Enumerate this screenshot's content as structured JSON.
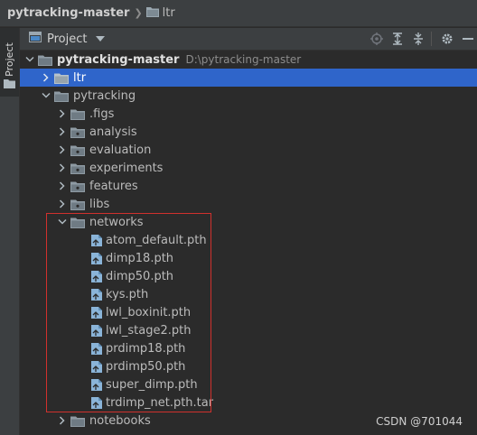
{
  "breadcrumb": {
    "root": "pytracking-master",
    "child": "ltr"
  },
  "side_tab": {
    "label": "Project"
  },
  "tool_window": {
    "title": "Project",
    "icons": [
      "locate-icon",
      "expand-all-icon",
      "collapse-all-icon",
      "settings-gear-icon",
      "hide-icon"
    ]
  },
  "tree": {
    "root": {
      "name": "pytracking-master",
      "path": "D:\\pytracking-master"
    },
    "items": [
      {
        "name": "ltr",
        "type": "folder",
        "expanded": false,
        "selected": true
      },
      {
        "name": "pytracking",
        "type": "folder",
        "expanded": true
      },
      {
        "name": ".figs",
        "type": "folder",
        "expanded": false
      },
      {
        "name": "analysis",
        "type": "folder",
        "expanded": false
      },
      {
        "name": "evaluation",
        "type": "folder",
        "expanded": false
      },
      {
        "name": "experiments",
        "type": "folder",
        "expanded": false
      },
      {
        "name": "features",
        "type": "folder",
        "expanded": false
      },
      {
        "name": "libs",
        "type": "folder",
        "expanded": false
      },
      {
        "name": "networks",
        "type": "folder",
        "expanded": true
      },
      {
        "name": "atom_default.pth",
        "type": "file"
      },
      {
        "name": "dimp18.pth",
        "type": "file"
      },
      {
        "name": "dimp50.pth",
        "type": "file"
      },
      {
        "name": "kys.pth",
        "type": "file"
      },
      {
        "name": "lwl_boxinit.pth",
        "type": "file"
      },
      {
        "name": "lwl_stage2.pth",
        "type": "file"
      },
      {
        "name": "prdimp18.pth",
        "type": "file"
      },
      {
        "name": "prdimp50.pth",
        "type": "file"
      },
      {
        "name": "super_dimp.pth",
        "type": "file"
      },
      {
        "name": "trdimp_net.pth.tar",
        "type": "file"
      },
      {
        "name": "notebooks",
        "type": "folder",
        "expanded": false
      }
    ]
  },
  "watermark": "CSDN @701044",
  "colors": {
    "selection": "#2f65ca",
    "highlight_box": "#d0312d",
    "background": "#2b2b2b",
    "panel": "#3c3f41"
  }
}
